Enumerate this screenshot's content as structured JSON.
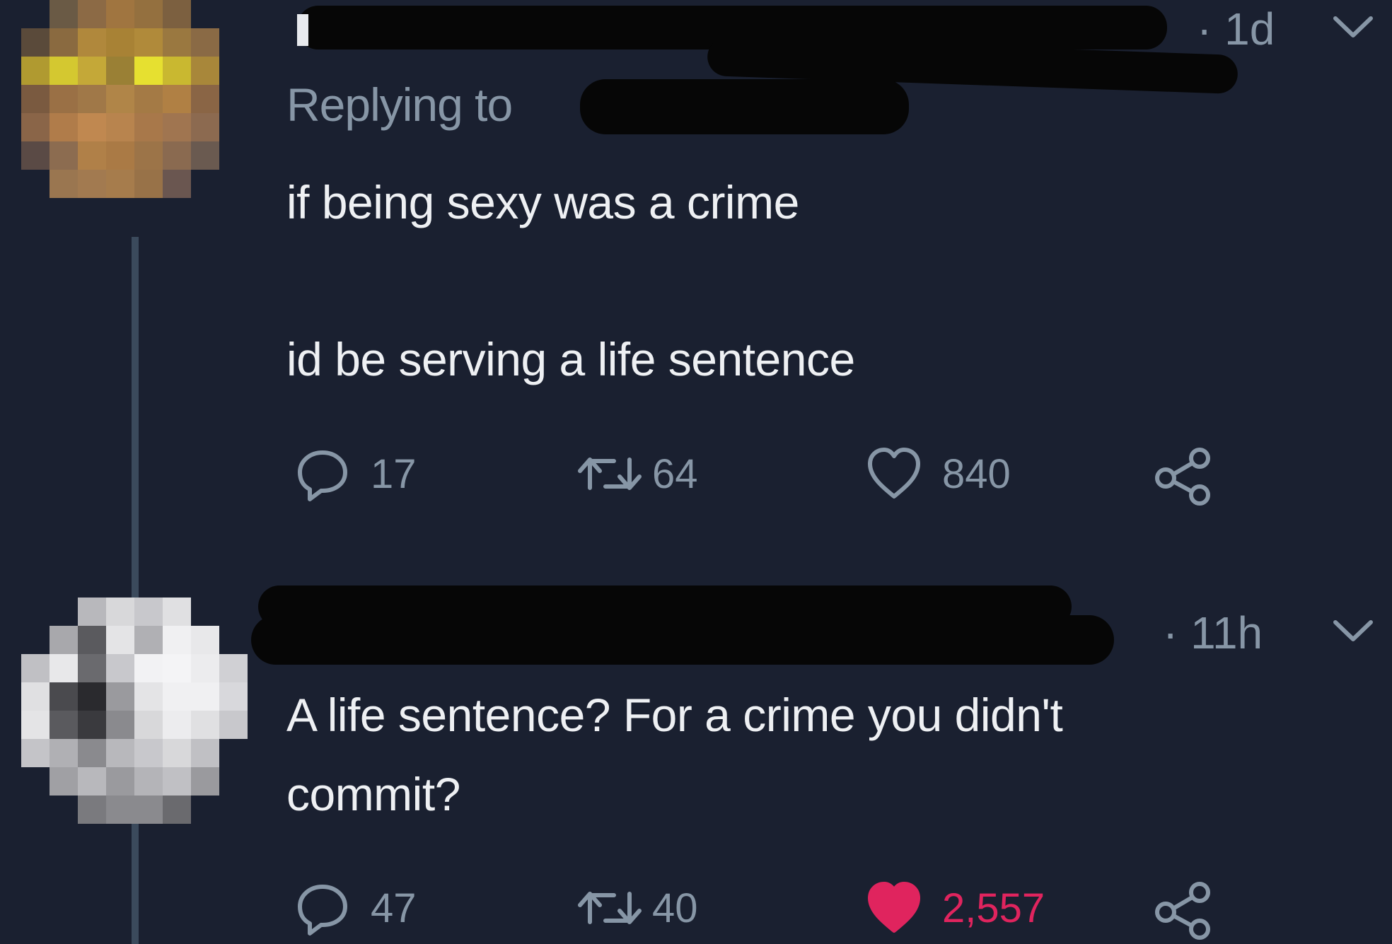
{
  "tweet1": {
    "timestamp": "· 1d",
    "replying_prefix": "Replying to",
    "text_line1": "if being sexy was a crime",
    "text_line2": "id be serving a life sentence",
    "actions": {
      "replies": "17",
      "retweets": "64",
      "likes": "840"
    }
  },
  "tweet2": {
    "timestamp": "· 11h",
    "text_line1": "A life sentence? For a crime you didn't",
    "text_line2": "commit?",
    "actions": {
      "replies": "47",
      "retweets": "40",
      "likes": "2,557"
    },
    "liked": true
  },
  "colors": {
    "background": "#1a2030",
    "muted": "#8796a6",
    "text": "#eef0f3",
    "like_red": "#e0245e",
    "thread_line": "#3b4a5c"
  },
  "icons": {
    "reply": "reply-icon",
    "retweet": "retweet-icon",
    "like": "heart-icon",
    "share": "share-icon",
    "menu": "chevron-down-icon"
  }
}
